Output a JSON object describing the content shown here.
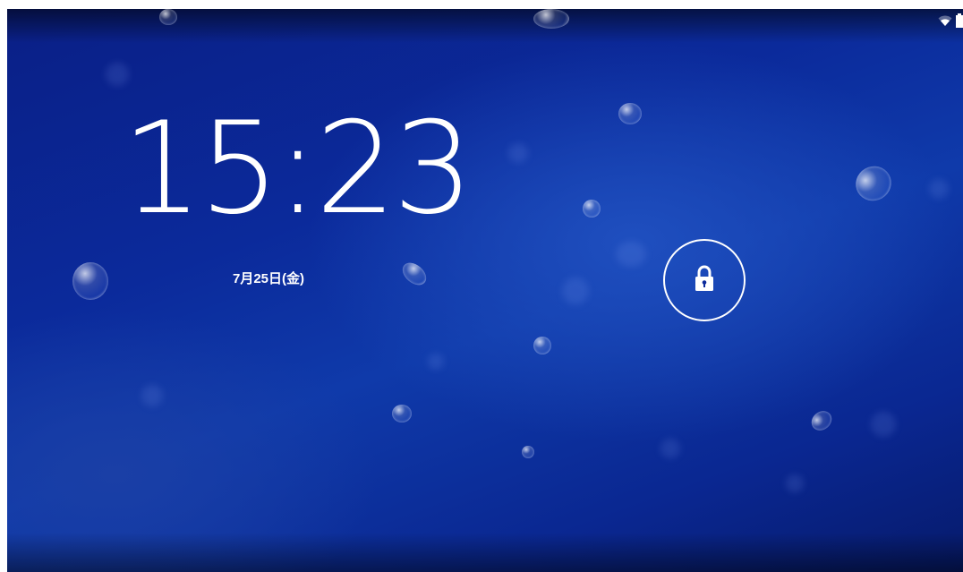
{
  "lockscreen": {
    "time": "15:23",
    "date": "7月25日(金)"
  },
  "status_bar": {
    "icons": [
      "wifi-icon",
      "battery-icon"
    ]
  },
  "unlock": {
    "icon": "lock-icon"
  },
  "colors": {
    "wallpaper": "#0b2a9b",
    "text": "#ffffff"
  }
}
